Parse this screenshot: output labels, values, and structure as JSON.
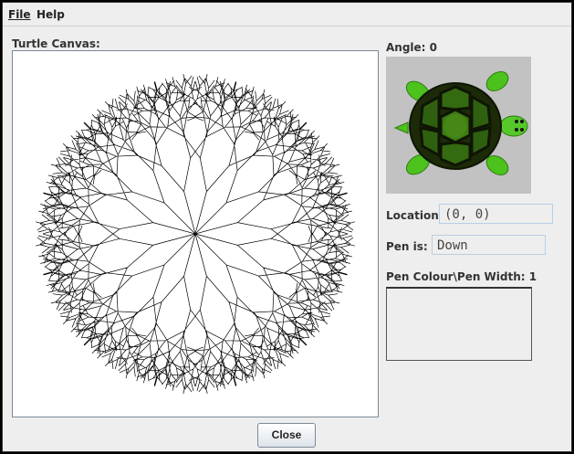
{
  "menu": {
    "file": "File",
    "help": "Help"
  },
  "canvas": {
    "label": "Turtle Canvas:"
  },
  "angle": {
    "label": "Angle:",
    "value": "0"
  },
  "location": {
    "label": "Location:",
    "value": "(0, 0)"
  },
  "pen": {
    "label": "Pen is:",
    "value": "Down"
  },
  "pen_colour": {
    "label": "Pen Colour\\Pen Width:",
    "width": "1"
  },
  "close_button": "Close",
  "drawing": {
    "arms": 12,
    "depth": 7,
    "trunk_length": 48,
    "length_ratio": 0.78,
    "branch_angle_deg": 26,
    "stroke_color": "#000000"
  },
  "colors": {
    "turtle_shell": "#3a6a10",
    "turtle_body": "#56c02a",
    "turtle_bg": "#c2c2c2"
  }
}
